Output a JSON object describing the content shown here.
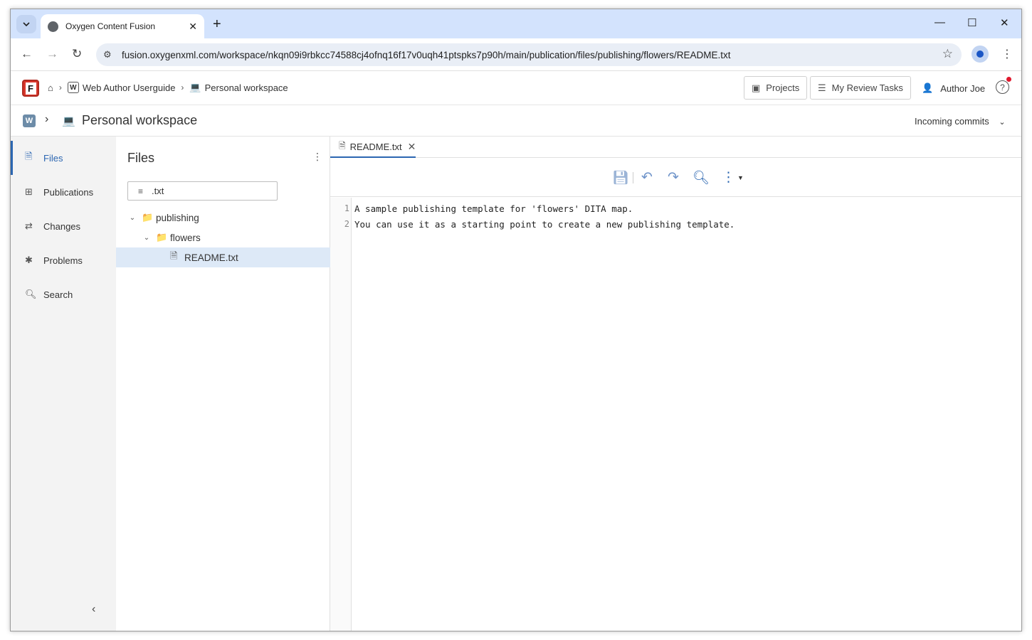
{
  "browser": {
    "tab_title": "Oxygen Content Fusion",
    "url": "fusion.oxygenxml.com/workspace/nkqn09i9rbkcc74588cj4ofnq16f17v0uqh41ptspks7p90h/main/publication/files/publishing/flowers/README.txt"
  },
  "header": {
    "breadcrumb": [
      "Web Author Userguide",
      "Personal workspace"
    ],
    "projects_label": "Projects",
    "review_tasks_label": "My Review Tasks",
    "user_name": "Author Joe"
  },
  "workspace": {
    "title": "Personal workspace",
    "incoming_label": "Incoming commits"
  },
  "sidebar": {
    "items": [
      {
        "label": "Files",
        "icon": "file-icon",
        "active": true
      },
      {
        "label": "Publications",
        "icon": "tree-icon"
      },
      {
        "label": "Changes",
        "icon": "swap-icon"
      },
      {
        "label": "Problems",
        "icon": "bug-icon"
      },
      {
        "label": "Search",
        "icon": "search-icon"
      }
    ]
  },
  "files_panel": {
    "title": "Files",
    "filter_value": ".txt",
    "tree": [
      {
        "label": "publishing",
        "type": "folder",
        "depth": 0
      },
      {
        "label": "flowers",
        "type": "folder",
        "depth": 1
      },
      {
        "label": "README.txt",
        "type": "file",
        "depth": 2,
        "selected": true
      }
    ]
  },
  "editor": {
    "tab_label": "README.txt",
    "lines": [
      {
        "number": "1",
        "text": "A sample publishing template for 'flowers' DITA map."
      },
      {
        "number": "2",
        "text": "You can use it as a starting point to create a new publishing template."
      }
    ]
  },
  "colors": {
    "accent": "#2b66b1",
    "selected_row": "#dde9f7",
    "sidebar_bg": "#f3f3f3"
  }
}
